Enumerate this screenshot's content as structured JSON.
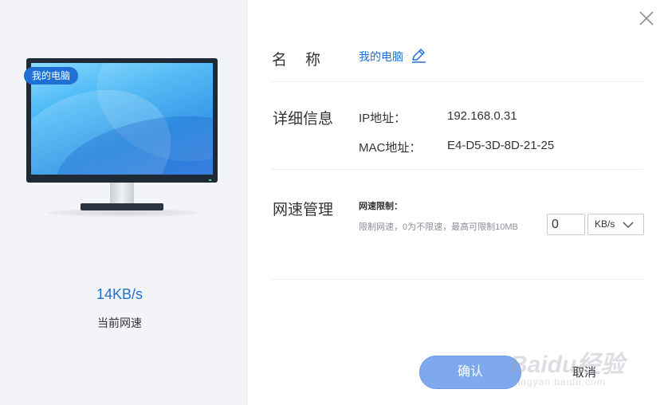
{
  "device_panel": {
    "badge": "我的电脑",
    "speed_value": "14KB/s",
    "speed_label": "当前网速"
  },
  "name_row": {
    "label": "名　称",
    "value": "我的电脑"
  },
  "details_row": {
    "label": "详细信息",
    "items": [
      {
        "key": "IP地址：",
        "value": "192.168.0.31"
      },
      {
        "key": "MAC地址：",
        "value": "E4-D5-3D-8D-21-25"
      }
    ]
  },
  "speed_row": {
    "label": "网速管理",
    "limit_title": "网速限制：",
    "limit_hint": "限制网速，0为不限速，最高可限制10MB",
    "limit_value": "0",
    "unit": "KB/s"
  },
  "actions": {
    "confirm": "确认",
    "cancel": "取消"
  },
  "watermark": {
    "brand": "Baidu经验",
    "sub": "jingyan.baidu.com"
  },
  "colors": {
    "accent": "#1f6fd4",
    "confirm_bg": "#7fa9ee",
    "left_bg": "#f2f4f7"
  },
  "icons": [
    "close-icon",
    "edit-icon",
    "chevron-down-icon",
    "monitor-icon"
  ]
}
